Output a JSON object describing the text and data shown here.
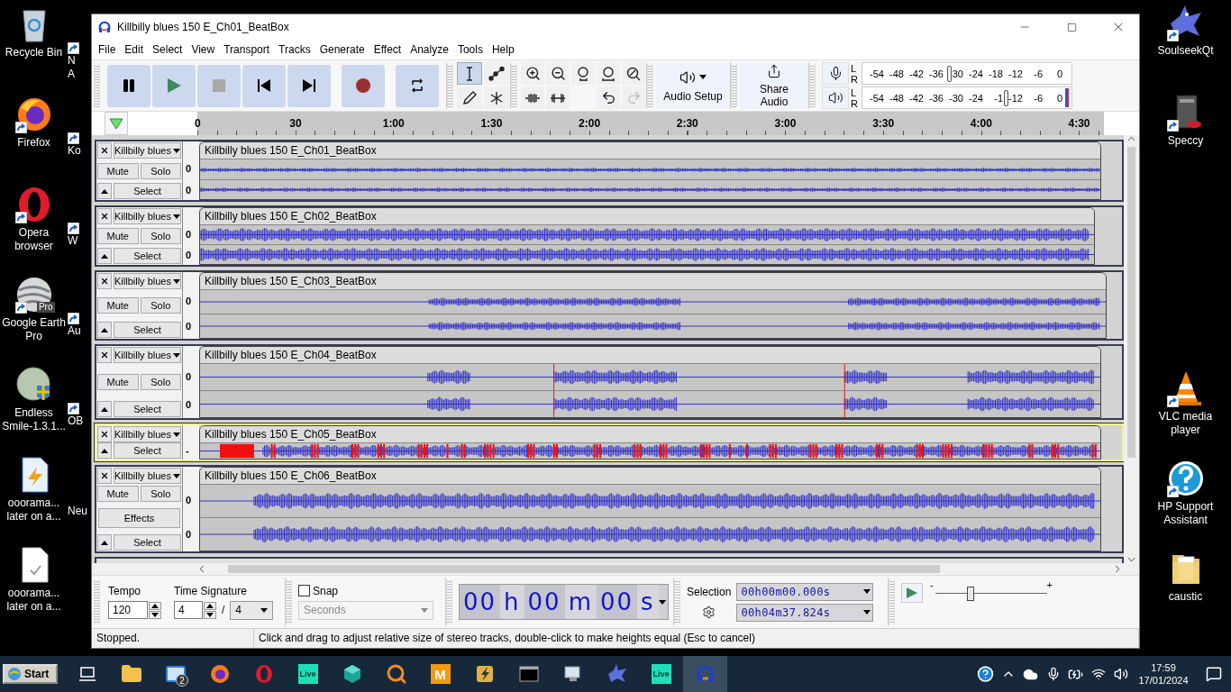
{
  "desktop": {
    "left_icons": [
      {
        "label": "Recycle Bin",
        "kind": "recycle-bin",
        "shortcut": false
      },
      {
        "label": "Firefox",
        "kind": "firefox",
        "shortcut": true
      },
      {
        "label": "Opera browser",
        "kind": "opera",
        "shortcut": true
      },
      {
        "label": "Google Earth Pro",
        "kind": "globe",
        "shortcut": true,
        "badge": "Pro"
      },
      {
        "label": "Endless Smile-1.3.1...",
        "kind": "installer",
        "shortcut": false
      },
      {
        "label": "ooorama... later on a...",
        "kind": "audio-file",
        "shortcut": false
      },
      {
        "label": "ooorama... later on a...",
        "kind": "blank-file",
        "shortcut": false
      }
    ],
    "hidden_icons": [
      {
        "lines": [
          "N",
          "A"
        ],
        "shortcut": true
      },
      {
        "lines": [
          "Ko"
        ],
        "shortcut": true
      },
      {
        "lines": [
          "W"
        ],
        "shortcut": true
      },
      {
        "lines": [
          "Au"
        ],
        "shortcut": true
      },
      {
        "lines": [
          "OB"
        ],
        "shortcut": true
      },
      {
        "lines": [
          "Neu"
        ],
        "shortcut": false
      }
    ],
    "right_icons_top": [
      {
        "label": "SoulseekQt",
        "kind": "bird",
        "shortcut": true
      },
      {
        "label": "Speccy",
        "kind": "computer",
        "shortcut": true
      }
    ],
    "right_icons_bottom": [
      {
        "label": "VLC media player",
        "kind": "cone",
        "shortcut": true
      },
      {
        "label": "HP Support Assistant",
        "kind": "help",
        "shortcut": true
      },
      {
        "label": "caustic",
        "kind": "folder",
        "shortcut": false
      }
    ]
  },
  "window": {
    "title": "Killbilly blues 150 E_Ch01_BeatBox"
  },
  "menu": [
    "File",
    "Edit",
    "Select",
    "View",
    "Transport",
    "Tracks",
    "Generate",
    "Effect",
    "Analyze",
    "Tools",
    "Help"
  ],
  "transport": [
    {
      "kind": "pause"
    },
    {
      "kind": "play"
    },
    {
      "kind": "stop"
    },
    {
      "kind": "skip-start"
    },
    {
      "kind": "skip-end"
    },
    {
      "kind": "record"
    },
    {
      "kind": "loop"
    }
  ],
  "tools": [
    {
      "kind": "select",
      "selected": true
    },
    {
      "kind": "envelope",
      "selected": false
    },
    {
      "kind": "draw",
      "selected": false
    },
    {
      "kind": "multi",
      "selected": false
    }
  ],
  "edit_tools": [
    {
      "kind": "zoom-in",
      "disabled": false
    },
    {
      "kind": "zoom-out",
      "disabled": false
    },
    {
      "kind": "fit-selection",
      "disabled": false
    },
    {
      "kind": "fit-project",
      "disabled": false
    },
    {
      "kind": "zoom-toggle",
      "disabled": false
    },
    {
      "kind": "trim",
      "disabled": false
    },
    {
      "kind": "silence",
      "disabled": false
    },
    {
      "kind": "gap"
    },
    {
      "kind": "undo",
      "disabled": false
    },
    {
      "kind": "redo",
      "disabled": true
    }
  ],
  "audio_setup": "Audio Setup",
  "share_audio": "Share Audio",
  "meters": [
    {
      "kind": "record",
      "channels": [
        "L",
        "R"
      ],
      "ticks": [
        "-54",
        "-48",
        "-42",
        "-36",
        "30",
        "-24",
        "-18",
        "-12",
        "-6",
        "0"
      ],
      "level": 0.405
    },
    {
      "kind": "playback",
      "channels": [
        "L",
        "R"
      ],
      "ticks": [
        "-54",
        "-48",
        "-42",
        "-36",
        "-30",
        "-24",
        "-1",
        "-12",
        "-6",
        "0"
      ],
      "level": 0.675
    }
  ],
  "ruler": [
    "0",
    "30",
    "1:00",
    "1:30",
    "2:00",
    "2:30",
    "3:00",
    "3:30",
    "4:00",
    "4:30"
  ],
  "tracks": [
    {
      "name": "Killbilly blues",
      "clip": "Killbilly blues 150 E_Ch01_BeatBox",
      "scale": [
        "0",
        "0"
      ],
      "mute": "Mute",
      "solo": "Solo",
      "select": "Select",
      "kind": "steady",
      "selected": false
    },
    {
      "name": "Killbilly blues",
      "clip": "Killbilly blues 150 E_Ch02_BeatBox",
      "scale": [
        "0",
        "0"
      ],
      "mute": "Mute",
      "solo": "Solo",
      "select": "Select",
      "kind": "dense",
      "selected": false
    },
    {
      "name": "Killbilly blues",
      "clip": "Killbilly blues 150 E_Ch03_BeatBox",
      "scale": [
        "0",
        "0"
      ],
      "mute": "Mute",
      "solo": "Solo",
      "select": "Select",
      "kind": "bursts",
      "selected": false
    },
    {
      "name": "Killbilly blues",
      "clip": "Killbilly blues 150 E_Ch04_BeatBox",
      "scale": [
        "0",
        "0"
      ],
      "mute": "Mute",
      "solo": "Solo",
      "select": "Select",
      "kind": "sparse",
      "selected": false
    },
    {
      "name": "Killbilly blues",
      "clip": "Killbilly blues 150 E_Ch05_BeatBox",
      "scale": [
        "-"
      ],
      "select": "Select",
      "kind": "clipped",
      "selected": true
    },
    {
      "name": "Killbilly blues",
      "clip": "Killbilly blues 150 E_Ch06_BeatBox",
      "scale": [
        "0",
        "0"
      ],
      "mute": "Mute",
      "solo": "Solo",
      "effects": "Effects",
      "select": "Select",
      "kind": "swell",
      "selected": false
    }
  ],
  "tempo": {
    "label": "Tempo",
    "value": "120"
  },
  "time_signature": {
    "label": "Time Signature",
    "upper": "4",
    "separator": "/",
    "lower": "4"
  },
  "snap": {
    "label": "Snap",
    "checked": false,
    "unit": "Seconds"
  },
  "time_display": [
    {
      "text": "00",
      "kind": "digits"
    },
    {
      "text": "h",
      "kind": "unit"
    },
    {
      "text": "00",
      "kind": "digits"
    },
    {
      "text": "m",
      "kind": "unit"
    },
    {
      "text": "00",
      "kind": "digits"
    },
    {
      "text": "s",
      "kind": "unit"
    }
  ],
  "selection": {
    "label": "Selection",
    "start": "00h00m00.000s",
    "end": "00h04m37.824s"
  },
  "play_speed": {
    "minus": "-",
    "plus": "+",
    "level": 0.33
  },
  "status_bar": [
    "Stopped.",
    "Click and drag to adjust relative size of stereo tracks, double-click to make heights equal (Esc to cancel)"
  ],
  "taskbar": {
    "start": "Start",
    "apps": [
      {
        "kind": "task-view",
        "selected": false
      },
      {
        "kind": "folder",
        "selected": false
      },
      {
        "kind": "mail",
        "badge": "2",
        "selected": false
      },
      {
        "kind": "firefox",
        "selected": false
      },
      {
        "kind": "opera",
        "selected": false
      },
      {
        "kind": "tile",
        "label": "Live",
        "selected": false
      },
      {
        "kind": "cube",
        "selected": false
      },
      {
        "kind": "search",
        "selected": false
      },
      {
        "kind": "tile-orange",
        "label": "M",
        "selected": false
      },
      {
        "kind": "winamp",
        "selected": false
      },
      {
        "kind": "terminal",
        "selected": false
      },
      {
        "kind": "monitor",
        "selected": false
      },
      {
        "kind": "bird",
        "selected": false
      },
      {
        "kind": "tile",
        "label": "Live",
        "selected": false
      },
      {
        "kind": "headphones",
        "selected": true
      }
    ],
    "time": "17:59",
    "date": "17/01/2024"
  }
}
